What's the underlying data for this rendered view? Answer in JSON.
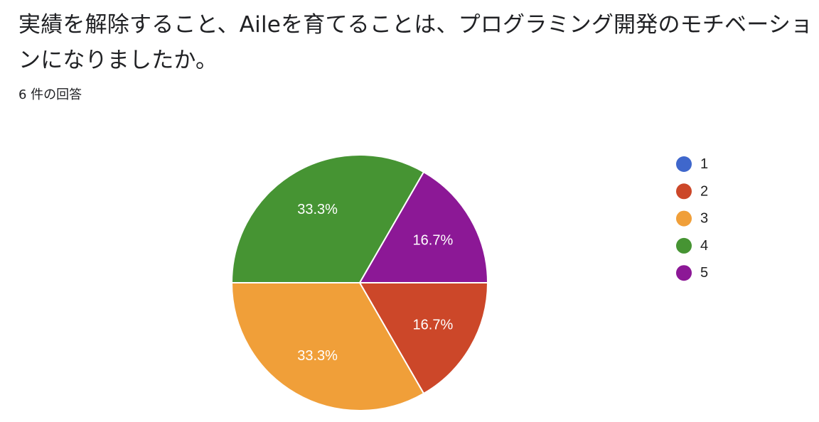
{
  "question": {
    "title": "実績を解除すること、Aileを育てることは、プログラミング開発のモチベーションになりましたか。",
    "response_count": "6 件の回答"
  },
  "chart_data": {
    "type": "pie",
    "categories": [
      "1",
      "2",
      "3",
      "4",
      "5"
    ],
    "values": [
      0,
      1,
      2,
      2,
      1
    ],
    "percent_labels": [
      "",
      "16.7%",
      "33.3%",
      "33.3%",
      "16.7%"
    ],
    "colors": [
      "#3f67cc",
      "#cc4729",
      "#f09f39",
      "#469433",
      "#8c1896"
    ],
    "legend_position": "right",
    "start_angle": "3 o'clock, clockwise"
  }
}
